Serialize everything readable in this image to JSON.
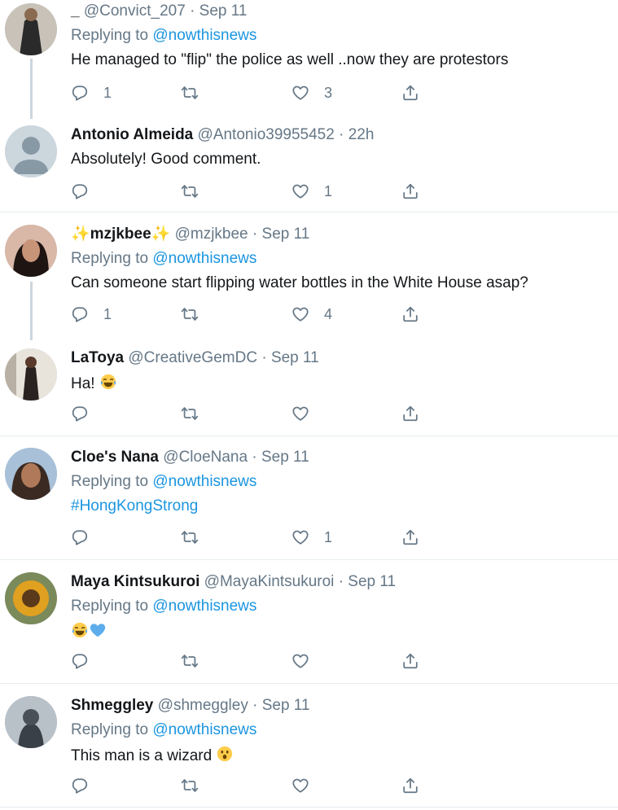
{
  "tweets": [
    {
      "name": "_",
      "handle": "@Convict_207",
      "time": "Sep 11",
      "replying_label": "Replying to",
      "replying_to": "@nowthisnews",
      "text": "He managed to \"flip\" the police as well ..now they are protestors",
      "replies": "1",
      "retweets": "",
      "likes": "3"
    },
    {
      "name": "Antonio Almeida",
      "handle": "@Antonio39955452",
      "time": "22h",
      "text": "Absolutely! Good comment.",
      "replies": "",
      "retweets": "",
      "likes": "1"
    },
    {
      "name": "✨mzjkbee✨",
      "handle": "@mzjkbee",
      "time": "Sep 11",
      "replying_label": "Replying to",
      "replying_to": "@nowthisnews",
      "text": "Can someone start flipping water bottles in the White House asap?",
      "replies": "1",
      "retweets": "",
      "likes": "4"
    },
    {
      "name": "LaToya",
      "handle": "@CreativeGemDC",
      "time": "Sep 11",
      "text": "Ha!",
      "replies": "",
      "retweets": "",
      "likes": ""
    },
    {
      "name": "Cloe's Nana",
      "handle": "@CloeNana",
      "time": "Sep 11",
      "replying_label": "Replying to",
      "replying_to": "@nowthisnews",
      "text": "#HongKongStrong",
      "replies": "",
      "retweets": "",
      "likes": "1"
    },
    {
      "name": "Maya Kintsukuroi",
      "handle": "@MayaKintsukuroi",
      "time": "Sep 11",
      "replying_label": "Replying to",
      "replying_to": "@nowthisnews",
      "text": "",
      "replies": "",
      "retweets": "",
      "likes": ""
    },
    {
      "name": "Shmeggley",
      "handle": "@shmeggley",
      "time": "Sep 11",
      "replying_label": "Replying to",
      "replying_to": "@nowthisnews",
      "text": "This man is a wizard",
      "replies": "",
      "retweets": "",
      "likes": ""
    }
  ],
  "separator": "·",
  "icons": {
    "reply": "reply-icon",
    "retweet": "retweet-icon",
    "like": "heart-icon",
    "share": "share-icon",
    "emoji_laugh": "tears-of-joy-emoji-icon",
    "emoji_heart": "blue-heart-emoji-icon",
    "emoji_astonished": "astonished-emoji-icon"
  },
  "colors": {
    "link": "#1b95e0",
    "secondary": "#657786",
    "divider": "#e6ecf0"
  }
}
